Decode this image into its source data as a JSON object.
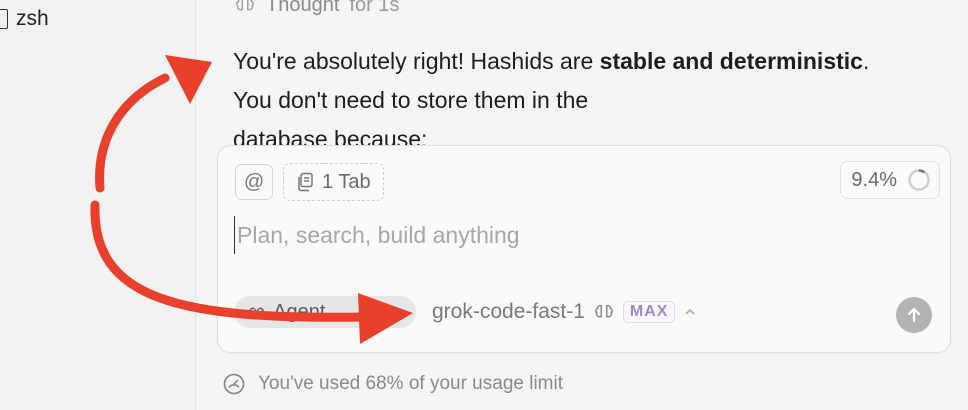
{
  "terminal": {
    "label": "zsh"
  },
  "thought": {
    "label": "Thought",
    "duration": "for 1s"
  },
  "message": {
    "lead": "You're absolutely right! Hashids are ",
    "bold": "stable and deterministic",
    "tail": ". You don't need to store them in the",
    "line3": "database because:"
  },
  "composer": {
    "at_label": "@",
    "tab_chip": "1 Tab",
    "usage_percent": "9.4%",
    "placeholder": "Plan, search, build anything",
    "agent_label": "Agent",
    "model_name": "grok-code-fast-1",
    "max_badge": "MAX"
  },
  "footer": {
    "usage_text": "You've used 68% of your usage limit"
  },
  "colors": {
    "annotation_arrow": "#e8402a",
    "max_badge": "#a08ac8"
  },
  "icons": [
    "terminal-icon",
    "brain-icon",
    "at-icon",
    "copy-icon",
    "progress-ring-icon",
    "infinity-icon",
    "chevron-up-icon",
    "arrow-up-icon",
    "gauge-icon"
  ]
}
